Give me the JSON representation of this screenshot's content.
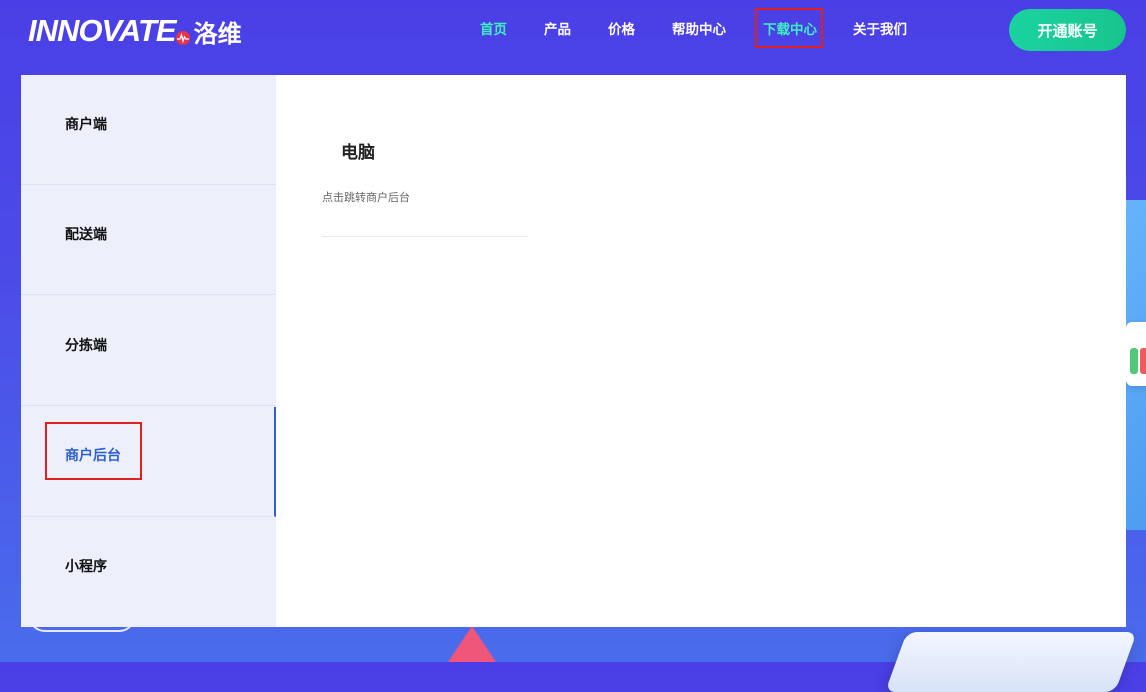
{
  "brand": {
    "logo_text": "INNOVATE",
    "logo_cn": "洛维"
  },
  "nav": {
    "items": [
      {
        "label": "首页",
        "state": "active"
      },
      {
        "label": "产品",
        "state": "normal"
      },
      {
        "label": "价格",
        "state": "normal"
      },
      {
        "label": "帮助中心",
        "state": "normal"
      },
      {
        "label": "下载中心",
        "state": "highlight"
      },
      {
        "label": "关于我们",
        "state": "normal"
      }
    ],
    "cta_label": "开通账号"
  },
  "sidebar": {
    "items": [
      {
        "label": "商户端"
      },
      {
        "label": "配送端"
      },
      {
        "label": "分拣端"
      },
      {
        "label": "商户后台",
        "active": true
      },
      {
        "label": "小程序"
      }
    ]
  },
  "content": {
    "title": "电脑",
    "link_text": "点击跳转商户后台"
  },
  "colors": {
    "accent": "#3ff0c2",
    "cta": "#1ad3a0",
    "active_side": "#2d5fd0",
    "highlight_box": "#e02020"
  }
}
